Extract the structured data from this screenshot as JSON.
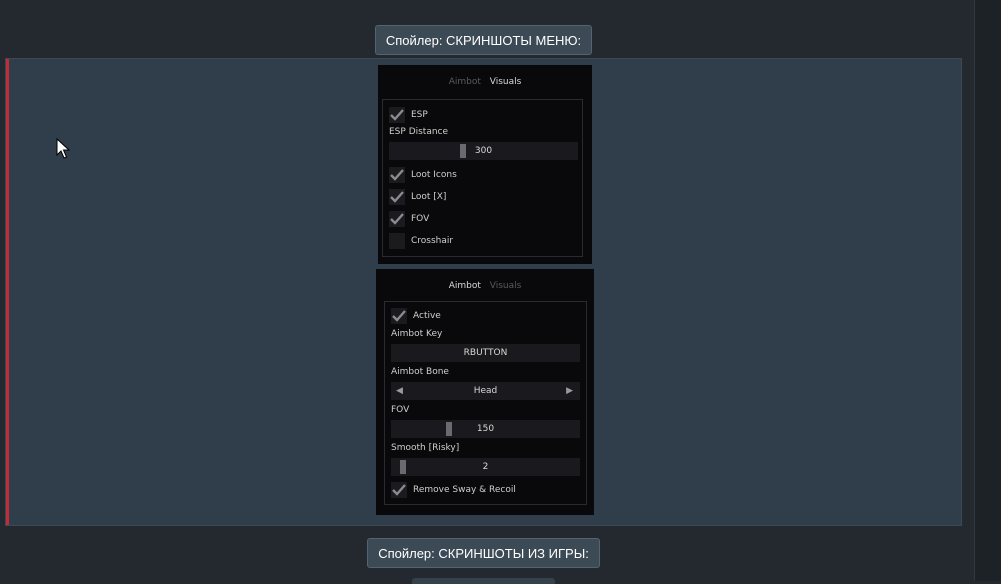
{
  "spoilers": {
    "menu_label": "Спойлер: СКРИНШОТЫ МЕНЮ:",
    "game_label": "Спойлер: СКРИНШОТЫ ИЗ ИГРЫ:"
  },
  "visuals_menu": {
    "tabs": [
      "Aimbot",
      "Visuals"
    ],
    "active_tab": "Visuals",
    "esp_label": "ESP",
    "esp_checked": true,
    "esp_distance_label": "ESP Distance",
    "esp_distance_value": "300",
    "esp_distance_fraction": 0.39,
    "loot_icons_label": "Loot Icons",
    "loot_icons_checked": true,
    "loot_x_label": "Loot [X]",
    "loot_x_checked": true,
    "fov_label": "FOV",
    "fov_checked": true,
    "crosshair_label": "Crosshair",
    "crosshair_checked": false
  },
  "aimbot_menu": {
    "tabs": [
      "Aimbot",
      "Visuals"
    ],
    "active_tab": "Aimbot",
    "active_label": "Active",
    "active_checked": true,
    "key_label": "Aimbot Key",
    "key_value": "RBUTTON",
    "bone_label": "Aimbot Bone",
    "bone_value": "Head",
    "fov_label": "FOV",
    "fov_value": "150",
    "fov_fraction": 0.3,
    "smooth_label": "Smooth [Risky]",
    "smooth_value": "2",
    "smooth_fraction": 0.05,
    "remove_sway_label": "Remove Sway & Recoil",
    "remove_sway_checked": true
  },
  "icons": [
    "check-icon",
    "arrow-left-icon",
    "arrow-right-icon",
    "mouse-cursor-icon"
  ],
  "colors": {
    "accent": "#c42b3a",
    "spoiler_bg": "#2f3e4a",
    "menu_bg": "#09090b"
  }
}
